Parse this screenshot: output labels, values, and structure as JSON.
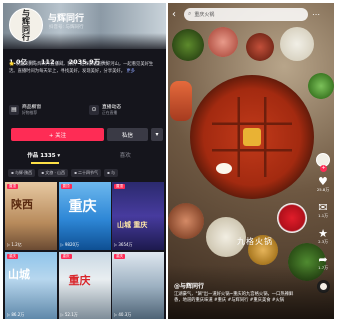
{
  "profile": {
    "avatar_text": [
      "与",
      "辉",
      "同",
      "行"
    ],
    "name": "与辉同行",
    "uid": "抖音号: 与辉同行",
    "stats": [
      {
        "num": "1.0亿",
        "label": "获赞"
      },
      {
        "num": "112",
        "label": "关注"
      },
      {
        "num": "2035.9万",
        "label": "粉丝"
      }
    ],
    "bio": "🌟 欢迎来到与辉同行直播间，我们一起探索祖国大好河山，一起看见美好生活。直播时间为每天早上，寻找美好，发现美好，分享美好。",
    "bio_more": "更多",
    "services": [
      {
        "icon": "▤",
        "title": "商品橱窗",
        "sub": "好物推荐"
      },
      {
        "icon": "⊙",
        "title": "直播动态",
        "sub": "正在直播"
      }
    ],
    "follow_label": "+ 关注",
    "message_label": "私信",
    "more_label": "▾"
  },
  "tabs": [
    {
      "label": "作品 1335 ▾",
      "active": true
    },
    {
      "label": "喜欢",
      "active": false
    }
  ],
  "chips": [
    "▪ 与辉·陕西",
    "▪ 文旅 · 山西",
    "▪ 二十四节气",
    "▪ 与"
  ],
  "grid": [
    {
      "tag": "置顶",
      "big": "陕西",
      "cap": "▷ 1.2亿"
    },
    {
      "tag": "置顶",
      "big": "重庆",
      "cap": "▷ 9820万"
    },
    {
      "tag": "置顶",
      "big": "山城 重庆",
      "cap": "▷ 3654万"
    },
    {
      "tag": "重庆",
      "big": "山城",
      "cap": "▷ 86.2万"
    },
    {
      "tag": "重庆",
      "big": "重庆",
      "cap": "▷ 52.1万"
    },
    {
      "tag": "重庆",
      "big": "",
      "cap": "▷ 40.3万"
    }
  ],
  "video": {
    "back": "‹",
    "search_icon": "⌕",
    "search_text": "重庆火锅",
    "more": "⋯",
    "side": [
      {
        "icon": "♥",
        "count": "25.8万"
      },
      {
        "icon": "✉",
        "count": "1.1万"
      },
      {
        "icon": "★",
        "count": "2.3万"
      },
      {
        "icon": "➦",
        "count": "1.7万"
      }
    ],
    "overlay_text": "九格火锅",
    "author": "@与辉同行",
    "description": "江湖豪气，\"涮\"出一道好火锅~重庆的九宫格火锅，一口热辣鲜香，地道的重庆味道 #重庆 #与辉同行 #重庆美食 #火锅"
  }
}
